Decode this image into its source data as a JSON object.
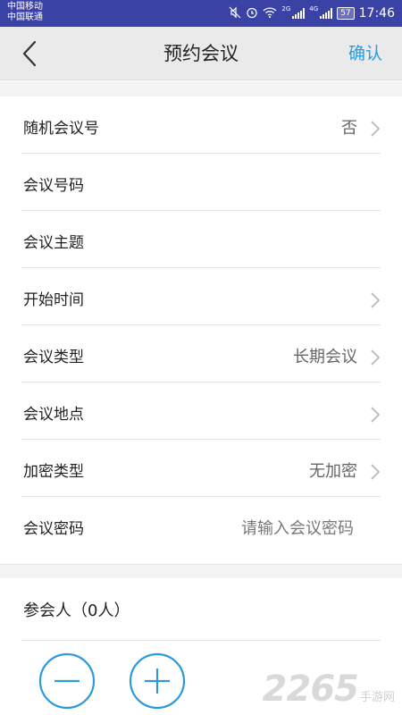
{
  "status_bar": {
    "carrier1": "中国移动",
    "carrier2": "中国联通",
    "net1": "2G",
    "net2": "4G",
    "battery": "57",
    "time": "17:46",
    "icons": [
      "mute-icon",
      "alarm-icon",
      "wifi-icon",
      "signal-icon",
      "signal-icon",
      "battery-icon"
    ],
    "color": "#3b42a6"
  },
  "nav": {
    "back_icon": "chevron-left-icon",
    "title": "预约会议",
    "confirm": "确认",
    "confirm_color": "#2b9bdc"
  },
  "form": {
    "rows": [
      {
        "label": "随机会议号",
        "value": "否",
        "chevron": true
      },
      {
        "label": "会议号码",
        "value": "",
        "chevron": false
      },
      {
        "label": "会议主题",
        "value": "",
        "chevron": false
      },
      {
        "label": "开始时间",
        "value": "",
        "chevron": true
      },
      {
        "label": "会议类型",
        "value": "长期会议",
        "chevron": true
      },
      {
        "label": "会议地点",
        "value": "",
        "chevron": true
      },
      {
        "label": "加密类型",
        "value": "无加密",
        "chevron": true
      },
      {
        "label": "会议密码",
        "placeholder": "请输入会议密码",
        "chevron": false
      }
    ]
  },
  "participants": {
    "label": "参会人（0人）"
  },
  "actions": {
    "remove_icon": "minus-circle-icon",
    "add_icon": "plus-circle-icon",
    "color": "#2b9bdc"
  },
  "watermark": {
    "number": "2265",
    "text": "手游网"
  }
}
